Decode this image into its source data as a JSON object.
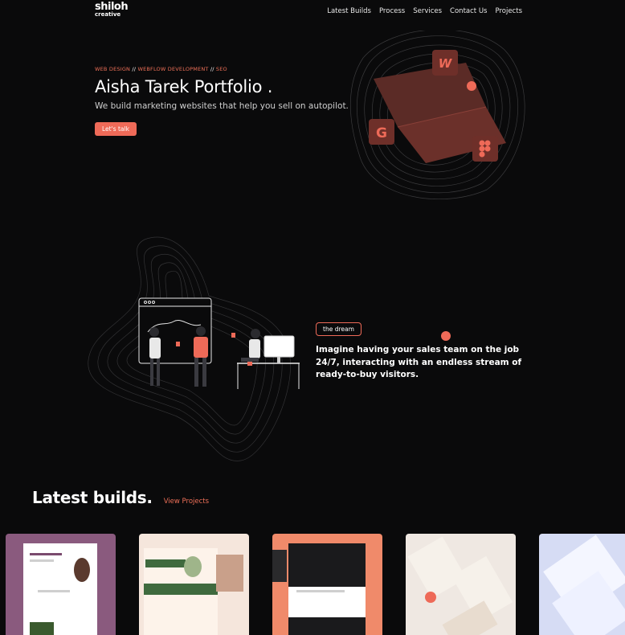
{
  "logo": {
    "line1": "shiloh",
    "line2": "creative"
  },
  "nav": {
    "items": [
      "Latest Builds",
      "Process",
      "Services",
      "Contact Us",
      "Projects"
    ]
  },
  "hero": {
    "tag1": "WEB DESIGN",
    "sep1": " // ",
    "tag2": "WEBFLOW DEVELOPMENT",
    "sep2": " // ",
    "tag3": "SEO",
    "title": "Aisha Tarek Portfolio .",
    "subtitle": "We build marketing websites that help you sell on autopilot.",
    "cta": "Let's talk"
  },
  "icons": {
    "webflow": "W",
    "google": "G"
  },
  "dream": {
    "pill": "the dream",
    "text": "Imagine having your sales team on the job 24/7, interacting with an endless stream of ready-to-buy visitors."
  },
  "builds": {
    "heading": "Latest builds.",
    "link": "View Projects"
  },
  "colors": {
    "accent": "#ee6a58",
    "background": "#0a0a0b"
  }
}
